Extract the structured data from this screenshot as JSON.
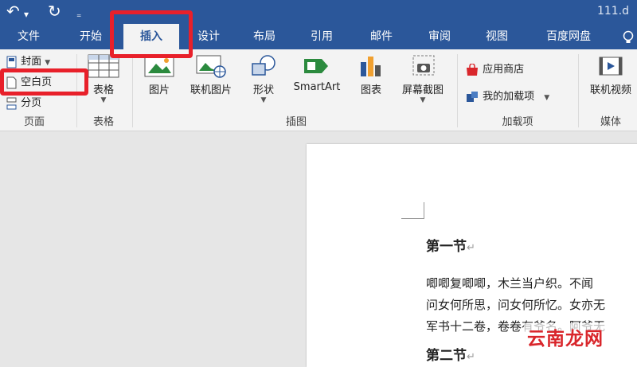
{
  "window": {
    "title": "111.d",
    "quick_access": {
      "undo": "↶",
      "undo_caret": "▾",
      "redo": "↻",
      "customize": "₌"
    }
  },
  "tabs": [
    {
      "label": "文件"
    },
    {
      "label": "开始"
    },
    {
      "label": "插入",
      "active": true
    },
    {
      "label": "设计"
    },
    {
      "label": "布局"
    },
    {
      "label": "引用"
    },
    {
      "label": "邮件"
    },
    {
      "label": "审阅"
    },
    {
      "label": "视图"
    },
    {
      "label": "百度网盘"
    }
  ],
  "ribbon": {
    "pages": {
      "cover": "封面",
      "blank": "空白页",
      "break": "分页",
      "label": "页面"
    },
    "tables": {
      "table": "表格",
      "label": "表格"
    },
    "illustrations": {
      "picture": "图片",
      "online_picture": "联机图片",
      "shapes": "形状",
      "smartart": "SmartArt",
      "chart": "图表",
      "screenshot": "屏幕截图",
      "label": "插图"
    },
    "addins": {
      "store": "应用商店",
      "my_addins": "我的加载项",
      "label": "加载项"
    },
    "media": {
      "online_video": "联机视频",
      "label": "媒体"
    }
  },
  "document": {
    "heading1": "第一节",
    "lines": [
      "唧唧复唧唧，木兰当户织。不闻",
      "问女何所思，问女何所忆。女亦无",
      "军书十二卷，卷卷有爷名。阿爷无"
    ],
    "heading2": "第二节"
  },
  "watermark": "云南龙网",
  "colors": {
    "accent": "#2b579a",
    "highlight": "#e8202a"
  }
}
